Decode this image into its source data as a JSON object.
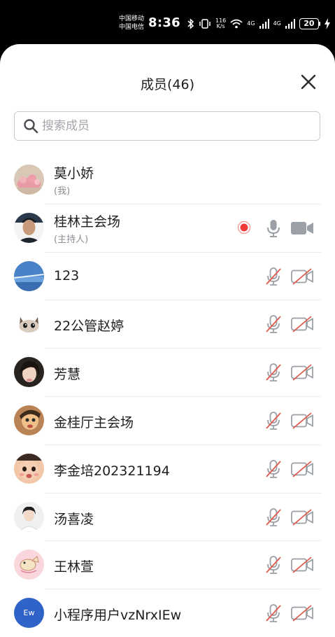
{
  "status_bar": {
    "carrier_1": "中国移动",
    "carrier_2": "中国电信",
    "time": "8:36",
    "speed_value": "116",
    "speed_unit": "K/s",
    "net_1": "4G",
    "net_2": "4G",
    "battery": "20"
  },
  "header": {
    "title": "成员(46)"
  },
  "search": {
    "placeholder": "搜索成员",
    "value": ""
  },
  "members": [
    {
      "name": "莫小娇",
      "sub": "(我)",
      "avatar": "photo-pink",
      "mic": "none",
      "cam": "none",
      "recording": false
    },
    {
      "name": "桂林主会场",
      "sub": "(主持人)",
      "avatar": "photo-man",
      "mic": "on",
      "cam": "on",
      "recording": true
    },
    {
      "name": "123",
      "sub": "",
      "avatar": "photo-sky",
      "mic": "muted",
      "cam": "off",
      "recording": false
    },
    {
      "name": "22公管赵婷",
      "sub": "",
      "avatar": "cartoon-cat",
      "mic": "muted",
      "cam": "off",
      "recording": false
    },
    {
      "name": "芳慧",
      "sub": "",
      "avatar": "photo-woman",
      "mic": "muted",
      "cam": "off",
      "recording": false
    },
    {
      "name": "金桂厅主会场",
      "sub": "",
      "avatar": "cartoon-character",
      "mic": "muted",
      "cam": "off",
      "recording": false
    },
    {
      "name": "李金培202321194",
      "sub": "",
      "avatar": "photo-child",
      "mic": "muted",
      "cam": "off",
      "recording": false
    },
    {
      "name": "汤喜凌",
      "sub": "",
      "avatar": "photo-portrait",
      "mic": "muted",
      "cam": "off",
      "recording": false
    },
    {
      "name": "王林萱",
      "sub": "",
      "avatar": "cartoon-pink",
      "mic": "muted",
      "cam": "off",
      "recording": false
    },
    {
      "name": "小程序用户vzNrxIEw",
      "sub": "",
      "avatar": "initials",
      "avatar_text": "Ew",
      "mic": "muted",
      "cam": "off",
      "recording": false
    }
  ],
  "colors": {
    "icon_gray": "#9aa0a6",
    "muted_slash": "#e05a4e",
    "recording": "#f03a3a",
    "initials_avatar": "#2f63c7"
  }
}
